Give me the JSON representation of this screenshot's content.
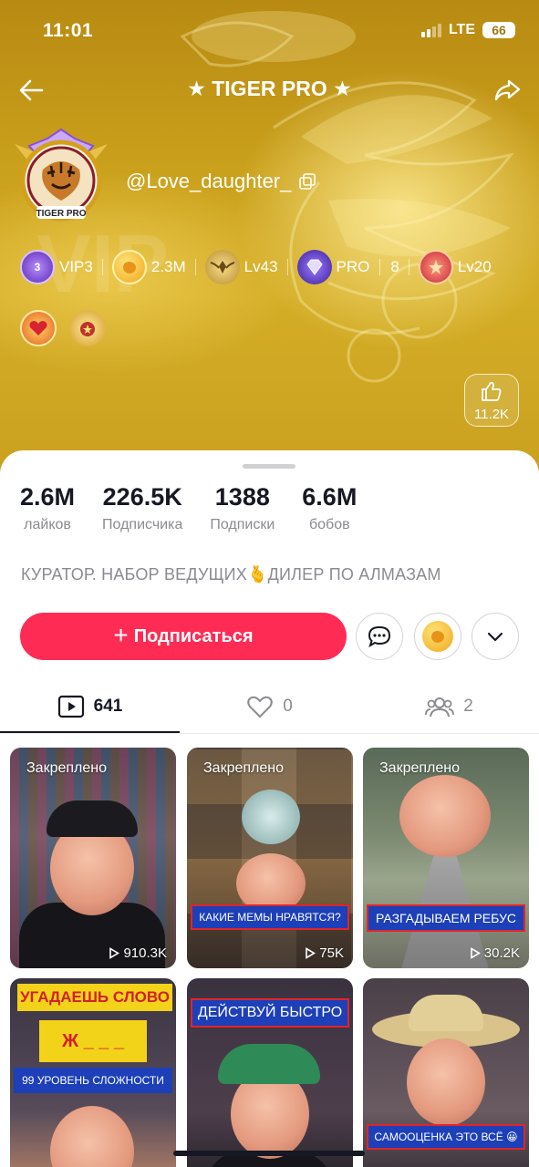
{
  "status_bar": {
    "time": "11:01",
    "network": "LTE",
    "battery": "66"
  },
  "header": {
    "title": "★ TIGER PRO ★",
    "back_icon": "arrow-left-icon",
    "share_icon": "share-arrow-icon"
  },
  "profile": {
    "username": "@Love_daughter_",
    "avatar_text": "TIGER PRO",
    "badges": [
      {
        "label": "VIP3",
        "icon": "vip-badge-icon",
        "badge_text": "3"
      },
      {
        "label": "2.3M",
        "icon": "coin-icon"
      },
      {
        "label": "Lv43",
        "icon": "level-wings-icon"
      },
      {
        "label": "PRO",
        "icon": "diamond-pro-icon",
        "extra": "8"
      },
      {
        "label": "Lv20",
        "icon": "fan-level-icon"
      }
    ],
    "likes_box": "11.2K"
  },
  "stats": [
    {
      "value": "2.6M",
      "label": "лайков"
    },
    {
      "value": "226.5K",
      "label": "Подписчика"
    },
    {
      "value": "1388",
      "label": "Подписки"
    },
    {
      "value": "6.6M",
      "label": "бобов"
    }
  ],
  "bio": "КУРАТОР. НАБОР ВЕДУЩИХ🫰ДИЛЕР ПО АЛМАЗАМ",
  "actions": {
    "follow": "Подписаться"
  },
  "tabs": [
    {
      "icon": "video-icon",
      "count": "641"
    },
    {
      "icon": "heart-icon",
      "count": "0"
    },
    {
      "icon": "people-icon",
      "count": "2"
    }
  ],
  "videos": [
    {
      "pinned": "Закреплено",
      "views": "910.3K",
      "caption": ""
    },
    {
      "pinned": "Закреплено",
      "views": "75K",
      "caption": "КАКИЕ МЕМЫ НРАВЯТСЯ?"
    },
    {
      "pinned": "Закреплено",
      "views": "30.2K",
      "caption": "РАЗГАДЫВАЕМ РЕБУС"
    },
    {
      "pinned": "",
      "views": "",
      "caption": "УГАДАЕШЬ СЛОВО",
      "sub": "99 УРОВЕНЬ СЛОЖНОСТИ",
      "word": "Ж _ _ _"
    },
    {
      "pinned": "",
      "views": "",
      "caption": "ДЕЙСТВУЙ БЫСТРО"
    },
    {
      "pinned": "",
      "views": "",
      "caption": "САМООЦЕНКА  ЭТО ВСЁ 😀"
    }
  ]
}
